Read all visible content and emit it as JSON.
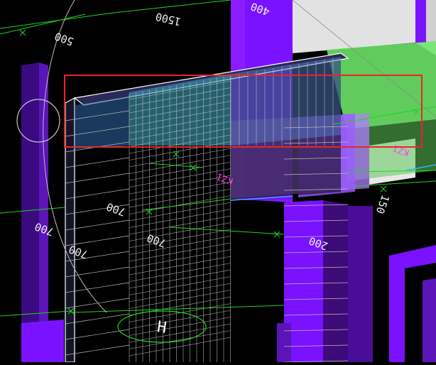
{
  "viewport": {
    "background": "#000000",
    "colors": {
      "purple": "#7a12ff",
      "purple_dark": "#3d0a7a",
      "purple_light": "#a55cff",
      "green_fill": "#6ee86a",
      "grid_line": "#d8d8d8",
      "dimension_line": "#1fd61f",
      "selection_box": "#e8262a",
      "label_magenta": "#ff3cff",
      "cyan": "#2bb8ff"
    }
  },
  "dimension_labels": {
    "top_left": "500",
    "top_center": "1500",
    "top_right": "400",
    "mid_left_a": "700",
    "mid_left_b": "700",
    "mid_left_c": "700",
    "mid_center": "700",
    "mid_right_a": "200",
    "mid_right_b": "150",
    "bottom_circle_label": "H",
    "magenta_a": "KZ1",
    "magenta_b": "KZ1"
  }
}
